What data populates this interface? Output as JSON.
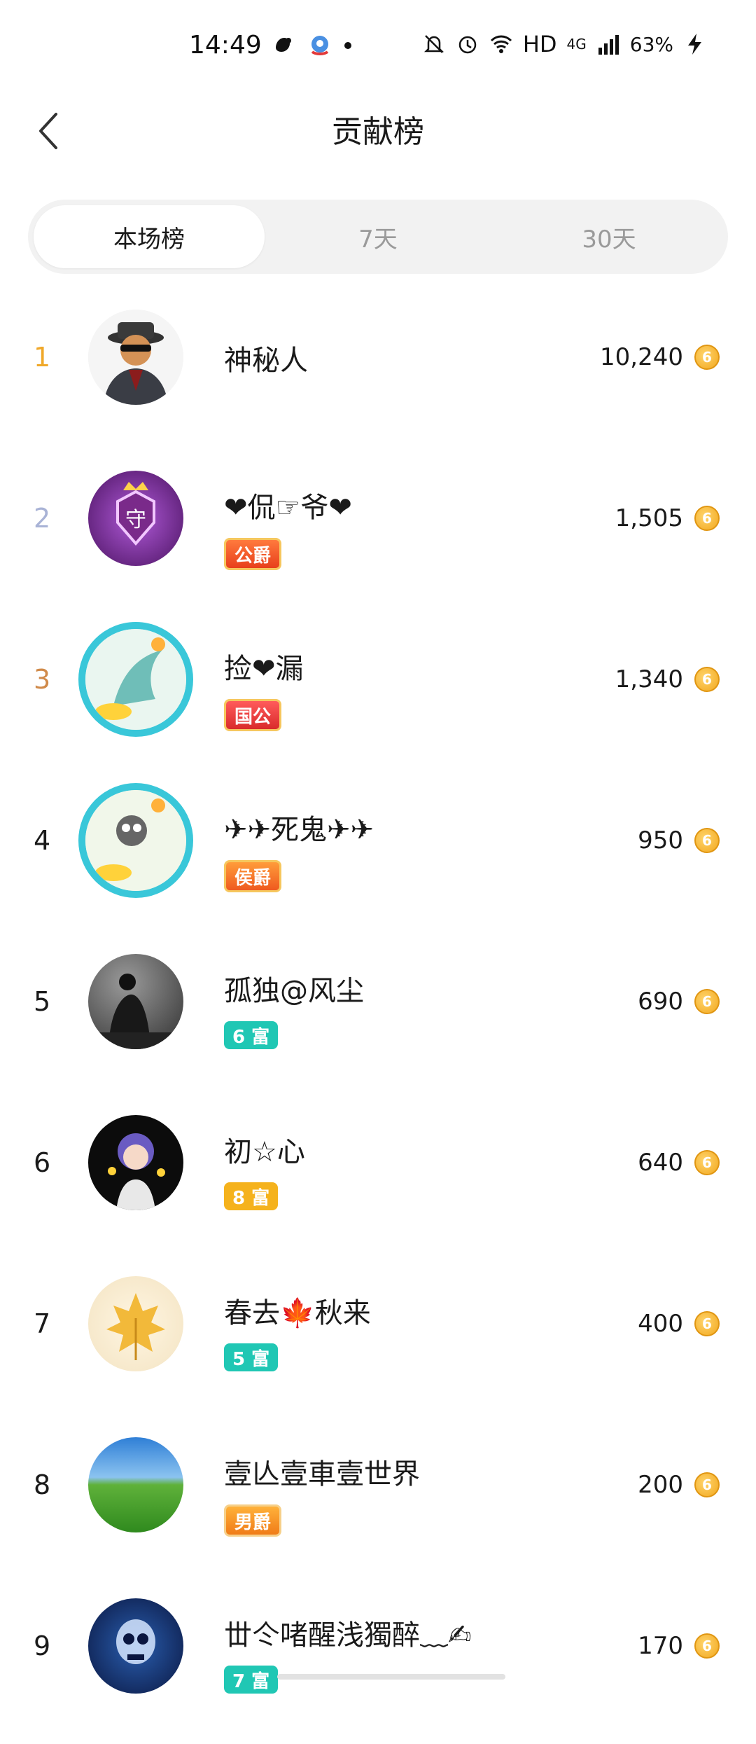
{
  "status_bar": {
    "time": "14:49",
    "network": "HD",
    "signal": "4G",
    "battery": "63%"
  },
  "header": {
    "title": "贡献榜",
    "back_icon": "chevron-left-icon"
  },
  "tabs": [
    {
      "label": "本场榜",
      "active": true
    },
    {
      "label": "7天",
      "active": false
    },
    {
      "label": "30天",
      "active": false
    }
  ],
  "ranking": [
    {
      "rank": "1",
      "name": "神秘人",
      "badge": "",
      "score": "10,240"
    },
    {
      "rank": "2",
      "name": "❤侃☞爷❤",
      "badge": "公爵",
      "score": "1,505"
    },
    {
      "rank": "3",
      "name": "捡❤漏",
      "badge": "国公",
      "score": "1,340"
    },
    {
      "rank": "4",
      "name": "✈✈死鬼✈✈",
      "badge": "侯爵",
      "score": "950"
    },
    {
      "rank": "5",
      "name": "孤独@风尘",
      "badge": "6 富",
      "score": "690"
    },
    {
      "rank": "6",
      "name": "初☆心",
      "badge": "8 富",
      "score": "640"
    },
    {
      "rank": "7",
      "name": "春去🍁秋来",
      "badge": "5 富",
      "score": "400"
    },
    {
      "rank": "8",
      "name": "壹亾壹車壹世界",
      "badge": "男爵",
      "score": "200"
    },
    {
      "rank": "9",
      "name": "丗仒啫醒浅獨醉﹏✍",
      "badge": "7 富",
      "score": "170"
    }
  ],
  "coin_glyph": "6",
  "colors": {
    "gold_rank": "#f0a82a",
    "silver_rank": "#a9b3d6",
    "bronze_rank": "#d08a4a",
    "teal_badge": "#20c7b4",
    "amber_badge": "#f5b21c",
    "coin": "#f2a81f"
  }
}
